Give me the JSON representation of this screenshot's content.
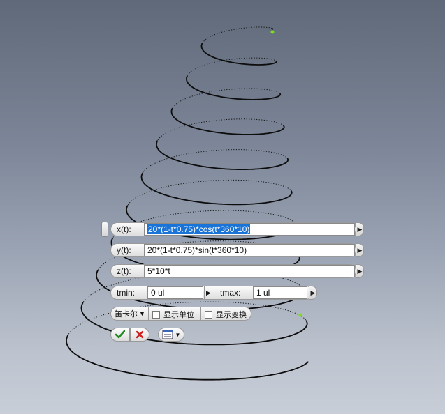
{
  "equation_panel": {
    "x_label": "x(t):",
    "x_expr": "20*(1-t*0.75)*cos(t*360*10)",
    "y_label": "y(t):",
    "y_expr": "20*(1-t*0.75)*sin(t*360*10)",
    "z_label": "z(t):",
    "z_expr": "5*10*t",
    "tmin_label": "tmin:",
    "tmin_value": "0 ul",
    "tmax_label": "tmax:",
    "tmax_value": "1 ul",
    "coord_system": "笛卡尔",
    "show_units": "显示单位",
    "show_transform": "显示变换"
  },
  "icons": {
    "ok": "check-icon",
    "cancel": "close-icon",
    "options": "options-menu-icon",
    "expand": "chevron-right-icon"
  },
  "colors": {
    "ok": "#1f8a1f",
    "cancel": "#cc2222",
    "selection": "#1a74d8",
    "endpoint": "#7fdc1e"
  }
}
